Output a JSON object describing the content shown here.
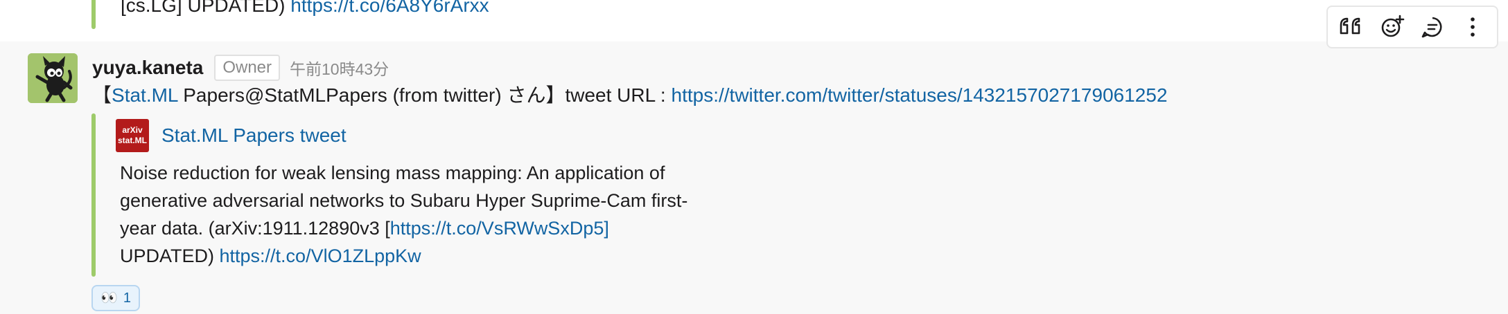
{
  "previous_message": {
    "text_prefix": "[cs.LG] UPDATED) ",
    "link": "https://t.co/6A8Y6rArxx"
  },
  "message": {
    "avatar_icon": "cat-avatar-icon",
    "username": "yuya.kaneta",
    "badge": "Owner",
    "timestamp": "午前10時43分",
    "body": {
      "open_bracket": "【",
      "channel_link": "Stat.ML",
      "middle_text": " Papers@StatMLPapers (from twitter) さん】tweet URL : ",
      "tweet_url": "https://twitter.com/twitter/statuses/1432157027179061252"
    },
    "attachment": {
      "icon_line1": "arXiv",
      "icon_line2": "stat.ML",
      "title": "Stat.ML Papers tweet",
      "text_line1": "Noise reduction for weak lensing mass mapping: An application of",
      "text_line2": "generative adversarial networks to Subaru Hyper Suprime-Cam first-",
      "text_line3_prefix": "year data. (arXiv:1911.12890v3 [",
      "text_line3_link": "https://t.co/VsRWwSxDp5]",
      "text_line4_prefix": "UPDATED) ",
      "text_line4_link": "https://t.co/VlO1ZLppKw"
    },
    "reaction": {
      "emoji": "👀",
      "count": "1"
    }
  },
  "toolbar": {
    "quote_icon": "quote-icon",
    "add_reaction_icon": "add-reaction-icon",
    "reply_thread_icon": "reply-thread-icon",
    "more_icon": "more-vertical-icon"
  },
  "colors": {
    "link": "#1264a3",
    "attachment_bar": "#9ecb6a",
    "arxiv_red": "#b31b1b"
  }
}
